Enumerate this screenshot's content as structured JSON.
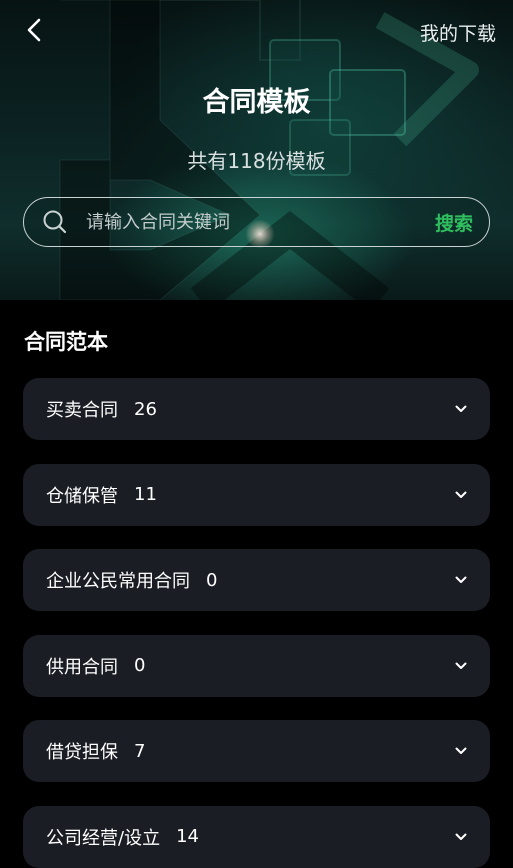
{
  "header": {
    "back_icon": "chevron-left-icon",
    "downloads_label": "我的下载",
    "title": "合同模板",
    "subtitle": "共有118份模板"
  },
  "search": {
    "icon": "search-icon",
    "placeholder": "请输入合同关键词",
    "value": "",
    "button_label": "搜索",
    "accent_color": "#2fbf5f"
  },
  "section": {
    "title": "合同范本"
  },
  "categories": [
    {
      "name": "买卖合同",
      "count": "26"
    },
    {
      "name": "仓储保管",
      "count": "11"
    },
    {
      "name": "企业公民常用合同",
      "count": "0"
    },
    {
      "name": "供用合同",
      "count": "0"
    },
    {
      "name": "借贷担保",
      "count": "7"
    },
    {
      "name": "公司经营/设立",
      "count": "14"
    }
  ],
  "colors": {
    "background": "#000000",
    "card": "#1b1d25",
    "accent": "#2fbf5f"
  }
}
